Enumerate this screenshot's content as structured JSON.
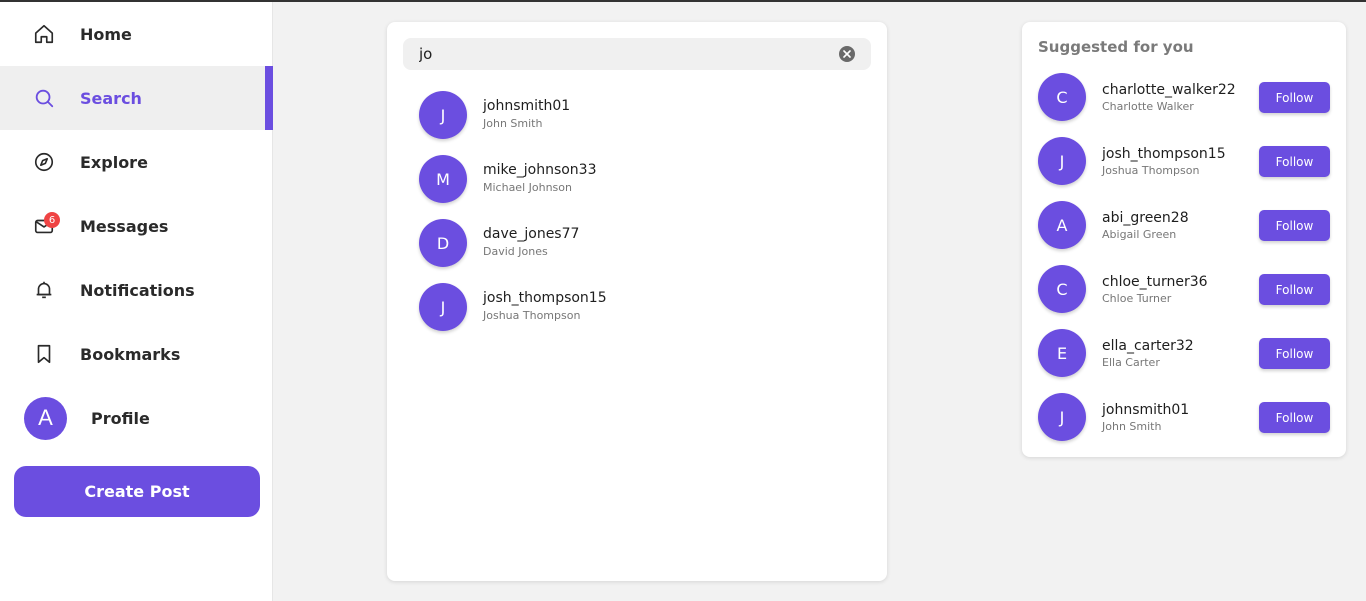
{
  "nav": {
    "items": [
      {
        "label": "Home",
        "icon": "home-icon"
      },
      {
        "label": "Search",
        "icon": "search-icon",
        "active": true
      },
      {
        "label": "Explore",
        "icon": "compass-icon"
      },
      {
        "label": "Messages",
        "icon": "mail-icon",
        "badge": "6"
      },
      {
        "label": "Notifications",
        "icon": "bell-icon"
      },
      {
        "label": "Bookmarks",
        "icon": "bookmark-icon"
      }
    ],
    "profile": {
      "label": "Profile",
      "avatar_initial": "A"
    },
    "create_post": "Create Post"
  },
  "search": {
    "value": "jo",
    "results": [
      {
        "initial": "J",
        "username": "johnsmith01",
        "name": "John Smith"
      },
      {
        "initial": "M",
        "username": "mike_johnson33",
        "name": "Michael Johnson"
      },
      {
        "initial": "D",
        "username": "dave_jones77",
        "name": "David Jones"
      },
      {
        "initial": "J",
        "username": "josh_thompson15",
        "name": "Joshua Thompson"
      }
    ]
  },
  "suggested": {
    "title": "Suggested for you",
    "follow_label": "Follow",
    "users": [
      {
        "initial": "C",
        "username": "charlotte_walker22",
        "name": "Charlotte Walker"
      },
      {
        "initial": "J",
        "username": "josh_thompson15",
        "name": "Joshua Thompson"
      },
      {
        "initial": "A",
        "username": "abi_green28",
        "name": "Abigail Green"
      },
      {
        "initial": "C",
        "username": "chloe_turner36",
        "name": "Chloe Turner"
      },
      {
        "initial": "E",
        "username": "ella_carter32",
        "name": "Ella Carter"
      },
      {
        "initial": "J",
        "username": "johnsmith01",
        "name": "John Smith"
      }
    ]
  },
  "colors": {
    "accent": "#6b4ee0",
    "badge": "#ef4444"
  }
}
